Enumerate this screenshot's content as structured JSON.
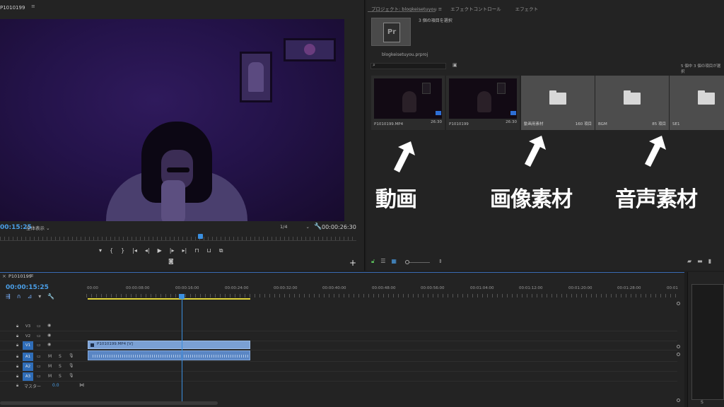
{
  "monitor": {
    "tab": "P1010199",
    "menu_icon": "≡",
    "timecode": "00:15:25",
    "fit": "全体表示",
    "resolution": "1/4",
    "duration": "00:00:26:30"
  },
  "project": {
    "tabs": [
      {
        "label": "プロジェクト: blogkeisetuyou"
      },
      {
        "label": "エフェクトコントロール"
      },
      {
        "label": "エフェクト"
      }
    ],
    "tab_menu_icon": "≡",
    "selected_count": "3 個の項目を選択",
    "file_name": "blogkeisetuyou.prproj",
    "items_status": "5 個中 3 個の項目が選択",
    "items": [
      {
        "name": "P1010199.MP4",
        "duration": "26:30"
      },
      {
        "name": "P1010199",
        "duration": "26:30"
      },
      {
        "name": "動画用素材",
        "count": "160 項目"
      },
      {
        "name": "BGM",
        "count": "85 項目"
      },
      {
        "name": "SE1",
        "count": ""
      }
    ]
  },
  "annotations": {
    "video": "動画",
    "image": "画像素材",
    "audio": "音声素材"
  },
  "timeline": {
    "tab": "P1010199",
    "menu_icon": "≡",
    "timecode": "00:00:15:25",
    "ticks": [
      "00:00",
      "00:00:08:00",
      "00:00:16:00",
      "00:00:24:00",
      "00:00:32:00",
      "00:00:40:00",
      "00:00:48:00",
      "00:00:56:00",
      "00:01:04:00",
      "00:01:12:00",
      "00:01:20:00",
      "00:01:28:00",
      "00:01"
    ],
    "tracks": [
      "V3",
      "V2",
      "V1",
      "A1",
      "A2",
      "A3"
    ],
    "clip_video": "P1010199.MP4 [V]",
    "master_label": "マスター",
    "master_value": "0.0",
    "track_m": "M",
    "track_s": "S"
  },
  "mini": {
    "label": "S"
  },
  "colors": {
    "accent": "#3a8fe0",
    "clip_video": "#7aa0d4",
    "clip_audio": "#5a86c4",
    "work_area": "#e0d43a"
  }
}
